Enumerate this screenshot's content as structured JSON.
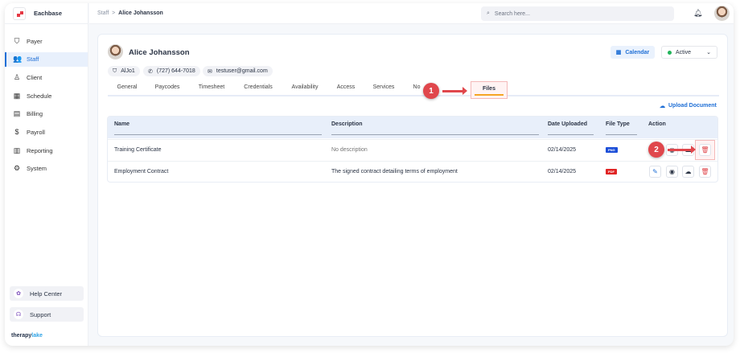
{
  "brand": "Eachbase",
  "sidebar": {
    "items": [
      {
        "label": "Payer",
        "icon": "shield-icon"
      },
      {
        "label": "Staff",
        "icon": "users-icon"
      },
      {
        "label": "Client",
        "icon": "user-icon"
      },
      {
        "label": "Schedule",
        "icon": "calendar-icon"
      },
      {
        "label": "Billing",
        "icon": "receipt-icon"
      },
      {
        "label": "Payroll",
        "icon": "money-icon"
      },
      {
        "label": "Reporting",
        "icon": "report-icon"
      },
      {
        "label": "System",
        "icon": "gear-icon"
      }
    ],
    "help": "Help Center",
    "support": "Support",
    "footer_a": "therapy",
    "footer_b": "lake"
  },
  "breadcrumb": {
    "parent": "Staff",
    "sep": ">",
    "current": "Alice Johansson"
  },
  "search": {
    "placeholder": "Search here..."
  },
  "profile": {
    "name": "Alice Johansson",
    "id": "AlJo1",
    "phone": "(727) 644-7018",
    "email": "testuser@gmail.com",
    "calendar": "Calendar",
    "status": "Active"
  },
  "tabs": [
    "General",
    "Paycodes",
    "Timesheet",
    "Credentials",
    "Availability",
    "Access",
    "Services",
    "No",
    "Files"
  ],
  "annotations": {
    "one": "1",
    "two": "2"
  },
  "upload": "Upload Document",
  "table": {
    "headers": [
      "Name",
      "Description",
      "Date Uploaded",
      "File Type",
      "Action"
    ],
    "rows": [
      {
        "name": "Training Certificate",
        "description": "No description",
        "date": "02/14/2025",
        "type": "PNG"
      },
      {
        "name": "Employment Contract",
        "description": "The signed contract detailing terms of employment",
        "date": "02/14/2025",
        "type": "PDF"
      }
    ]
  },
  "colors": {
    "accent": "#1f6fd6",
    "danger": "#e0474c",
    "png": "#1d4fd8",
    "pdf": "#e02424"
  }
}
